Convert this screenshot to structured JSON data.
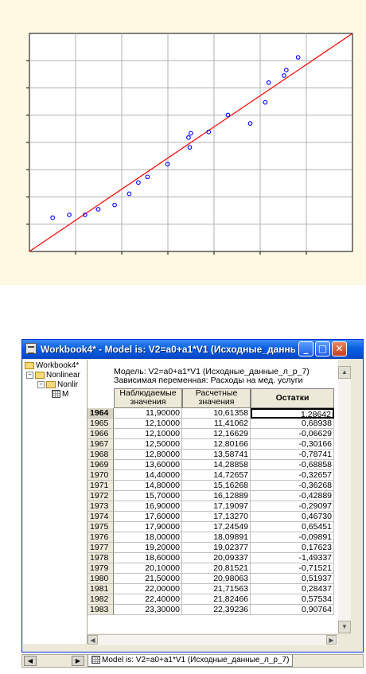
{
  "chart_data": {
    "type": "scatter",
    "points": [
      [
        10.61358,
        11.9
      ],
      [
        11.41062,
        12.1
      ],
      [
        12.16629,
        12.1
      ],
      [
        12.80166,
        12.5
      ],
      [
        13.58741,
        12.8
      ],
      [
        14.28858,
        13.6
      ],
      [
        14.72657,
        14.4
      ],
      [
        15.16268,
        14.8
      ],
      [
        16.12889,
        15.7
      ],
      [
        17.19097,
        16.9
      ],
      [
        17.1327,
        17.6
      ],
      [
        17.24549,
        17.9
      ],
      [
        18.09891,
        18.0
      ],
      [
        19.02377,
        19.2
      ],
      [
        20.09337,
        18.6
      ],
      [
        20.81521,
        20.1
      ],
      [
        20.98063,
        21.5
      ],
      [
        21.71563,
        22.0
      ],
      [
        21.82466,
        22.4
      ],
      [
        22.39236,
        23.3
      ]
    ],
    "fit_line": {
      "x": [
        9.5,
        25.0
      ],
      "y": [
        9.5,
        25.0
      ]
    },
    "xlim": [
      9.5,
      25.0
    ],
    "ylim": [
      9.5,
      25.0
    ],
    "marker_color": "#0000ff",
    "line_color": "#ff0000",
    "grid": true
  },
  "window": {
    "title": "Workbook4* - Model is: V2=a0+a1*V1 (Исходные_данны...",
    "buttons": {
      "minimize": "_",
      "maximize": "□",
      "close": "✕"
    }
  },
  "tree": {
    "root": "Workbook4*",
    "level1": "Nonlinear",
    "level2": "Nonlir",
    "level3": "M"
  },
  "sheet": {
    "header_line1": "Модель: V2=a0+a1*V1 (Исходные_данные_л_р_7)",
    "header_line2": "Зависимая переменная: Расходы на мед. услуги",
    "columns": [
      {
        "line1": "Наблюдаемые",
        "line2": "значения"
      },
      {
        "line1": "Расчетные",
        "line2": "значения"
      },
      {
        "line1": "Остатки",
        "line2": ""
      }
    ],
    "rows": [
      [
        "1964",
        "11,90000",
        "10,61358",
        "1,28642"
      ],
      [
        "1965",
        "12,10000",
        "11,41062",
        "0,68938"
      ],
      [
        "1966",
        "12,10000",
        "12,16629",
        "-0,06629"
      ],
      [
        "1967",
        "12,50000",
        "12,80166",
        "-0,30166"
      ],
      [
        "1968",
        "12,80000",
        "13,58741",
        "-0,78741"
      ],
      [
        "1969",
        "13,60000",
        "14,28858",
        "-0,68858"
      ],
      [
        "1970",
        "14,40000",
        "14,72657",
        "-0,32657"
      ],
      [
        "1971",
        "14,80000",
        "15,16268",
        "-0,36268"
      ],
      [
        "1972",
        "15,70000",
        "16,12889",
        "-0,42889"
      ],
      [
        "1973",
        "16,90000",
        "17,19097",
        "-0,29097"
      ],
      [
        "1974",
        "17,60000",
        "17,13270",
        "0,46730"
      ],
      [
        "1975",
        "17,90000",
        "17,24549",
        "0,65451"
      ],
      [
        "1976",
        "18,00000",
        "18,09891",
        "-0,09891"
      ],
      [
        "1977",
        "19,20000",
        "19,02377",
        "0,17623"
      ],
      [
        "1978",
        "18,60000",
        "20,09337",
        "-1,49337"
      ],
      [
        "1979",
        "20,10000",
        "20,81521",
        "-0,71521"
      ],
      [
        "1980",
        "21,50000",
        "20,98063",
        "0,51937"
      ],
      [
        "1981",
        "22,00000",
        "21,71563",
        "0,28437"
      ],
      [
        "1982",
        "22,40000",
        "21,82466",
        "0,57534"
      ],
      [
        "1983",
        "23,30000",
        "22,39236",
        "0,90764"
      ]
    ]
  },
  "tab": {
    "label": "Model is: V2=a0+a1*V1 (Исходные_данные_л_р_7)"
  }
}
